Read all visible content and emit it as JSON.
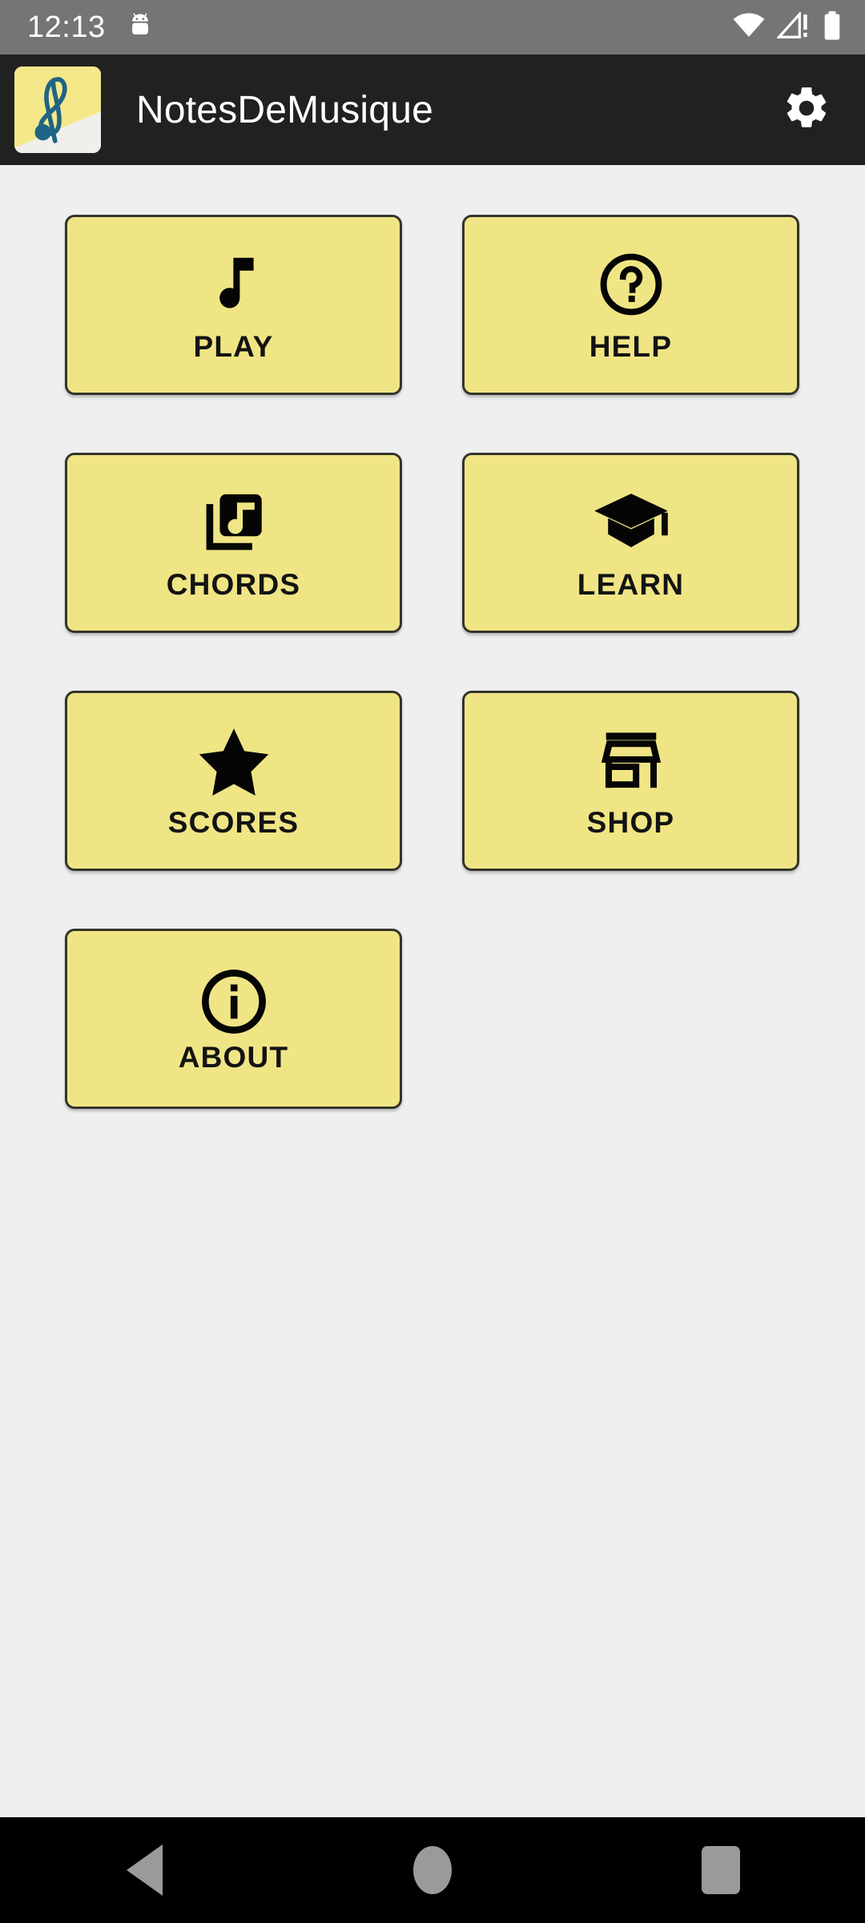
{
  "status_bar": {
    "clock": "12:13",
    "left_icons": [
      {
        "name": "android-bugdroid-icon",
        "glyph": "android"
      }
    ],
    "right_icons": [
      {
        "name": "wifi-icon",
        "glyph": "wifi-full"
      },
      {
        "name": "cellular-signal-no-service-icon",
        "glyph": "signal-alert"
      },
      {
        "name": "battery-icon",
        "glyph": "battery-full"
      }
    ],
    "background_color": "#757575",
    "foreground_color": "#FFFFFF"
  },
  "app_bar": {
    "title": "NotesDeMusique",
    "icon_name": "app-logo-treble-clef",
    "settings_icon_name": "gear-icon",
    "background_color": "#212121",
    "title_color": "#FFFFFF"
  },
  "theme": {
    "page_background": "#EFEFEF",
    "button_fill": "#F0E585",
    "button_border": "#34342C",
    "button_text": "#131313"
  },
  "menu": {
    "buttons": [
      {
        "id": "play",
        "label": "PLAY",
        "icon": "music-note-icon"
      },
      {
        "id": "help",
        "label": "HELP",
        "icon": "help-circle-icon"
      },
      {
        "id": "chords",
        "label": "CHORDS",
        "icon": "library-music-icon"
      },
      {
        "id": "learn",
        "label": "LEARN",
        "icon": "graduation-cap-icon"
      },
      {
        "id": "scores",
        "label": "SCORES",
        "icon": "star-icon"
      },
      {
        "id": "shop",
        "label": "SHOP",
        "icon": "storefront-icon"
      },
      {
        "id": "about",
        "label": "ABOUT",
        "icon": "info-circle-icon"
      }
    ]
  },
  "nav_bar": {
    "background_color": "#000000",
    "icon_color": "#9A9A9A",
    "buttons": [
      {
        "id": "back",
        "icon": "back-triangle-icon"
      },
      {
        "id": "home",
        "icon": "home-circle-icon"
      },
      {
        "id": "recents",
        "icon": "recents-square-icon"
      }
    ]
  }
}
